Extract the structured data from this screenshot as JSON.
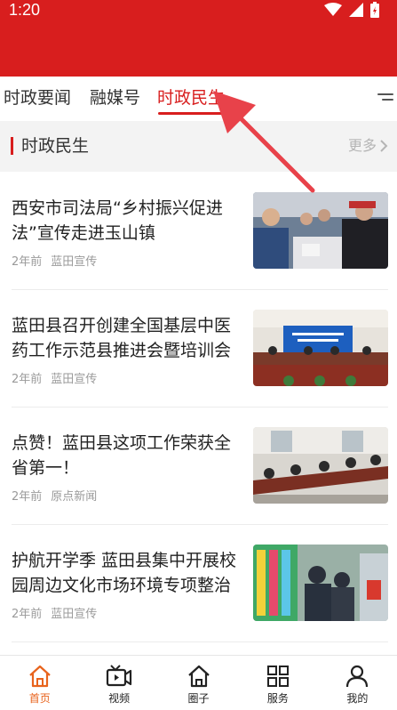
{
  "status_bar": {
    "time": "1:20"
  },
  "tabs": [
    {
      "label": "时政要闻",
      "active": false
    },
    {
      "label": "融媒号",
      "active": false
    },
    {
      "label": "时政民生",
      "active": true
    }
  ],
  "section": {
    "title": "时政民生",
    "more_label": "更多"
  },
  "news": [
    {
      "title": "西安市司法局“乡村振兴促进法”宣传走进玉山镇",
      "time": "2年前",
      "source": "蓝田宣传"
    },
    {
      "title": "蓝田县召开创建全国基层中医药工作示范县推进会暨培训会",
      "time": "2年前",
      "source": "蓝田宣传"
    },
    {
      "title": "点赞！蓝田县这项工作荣获全省第一！",
      "time": "2年前",
      "source": "原点新闻"
    },
    {
      "title": "护航开学季  蓝田县集中开展校园周边文化市场环境专项整治",
      "time": "2年前",
      "source": "蓝田宣传"
    }
  ],
  "bottom_nav": [
    {
      "label": "首页",
      "icon": "home-icon",
      "active": true
    },
    {
      "label": "视频",
      "icon": "video-icon",
      "active": false
    },
    {
      "label": "圈子",
      "icon": "circle-home-icon",
      "active": false
    },
    {
      "label": "服务",
      "icon": "grid-icon",
      "active": false
    },
    {
      "label": "我的",
      "icon": "user-icon",
      "active": false
    }
  ],
  "colors": {
    "brand_red": "#d81e1e",
    "nav_active": "#e8631c"
  }
}
